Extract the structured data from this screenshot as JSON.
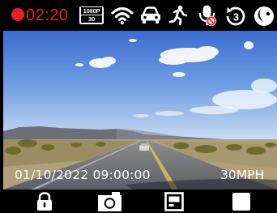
{
  "status_bar": {
    "recording_time": "02:20",
    "resolution_top": "1080P",
    "resolution_bottom": "30",
    "icons": [
      "recording-dot-icon",
      "resolution-badge",
      "wifi-icon",
      "car-icon",
      "motion-detection-icon",
      "microphone-muted-icon",
      "loop-recording-3-icon",
      "night-mode-icon"
    ],
    "loop_minutes": "3"
  },
  "overlay": {
    "datetime": "01/10/2022 09:00:00",
    "speed": "30MPH"
  },
  "bottom_bar": {
    "buttons": [
      "lock-icon",
      "camera-icon",
      "screen-display-icon",
      "stop-icon"
    ]
  },
  "colors": {
    "recording_red": "#e8202a",
    "icon_white": "#ffffff"
  }
}
